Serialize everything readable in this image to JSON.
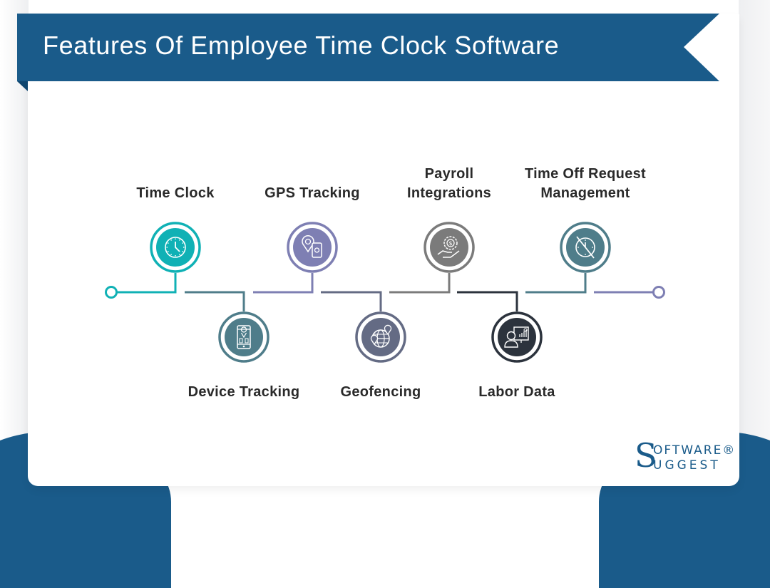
{
  "header": {
    "title": "Features Of Employee Time Clock Software",
    "banner_color": "#1a5b8a"
  },
  "features": [
    {
      "label": "Time Clock",
      "icon": "clock-icon",
      "color": "#10b1b5",
      "position": "top"
    },
    {
      "label": "Device Tracking",
      "icon": "mobile-device-location-icon",
      "color": "#4f7d8a",
      "position": "bottom"
    },
    {
      "label": "GPS Tracking",
      "icon": "gps-pin-phone-icon",
      "color": "#7e7fb3",
      "position": "top"
    },
    {
      "label": "Geofencing",
      "icon": "globe-location-icon",
      "color": "#646b84",
      "position": "bottom"
    },
    {
      "label": "Payroll Integrations",
      "label_lines": [
        "Payroll",
        "Integrations"
      ],
      "icon": "hand-dollar-gear-icon",
      "color": "#7b7b7b",
      "position": "top"
    },
    {
      "label": "Labor Data",
      "icon": "person-dashboard-icon",
      "color": "#2c333d",
      "position": "bottom"
    },
    {
      "label": "Time Off Request Management",
      "label_lines": [
        "Time Off Request",
        "Management"
      ],
      "icon": "clock-off-icon",
      "color": "#4f7d8a",
      "position": "top"
    }
  ],
  "timeline": {
    "start_color": "#10b1b5",
    "end_color": "#7e7fb3"
  },
  "logo": {
    "initial": "S",
    "line1": "OFTWARE®",
    "line2": "UGGEST",
    "color": "#1a5b8a"
  }
}
